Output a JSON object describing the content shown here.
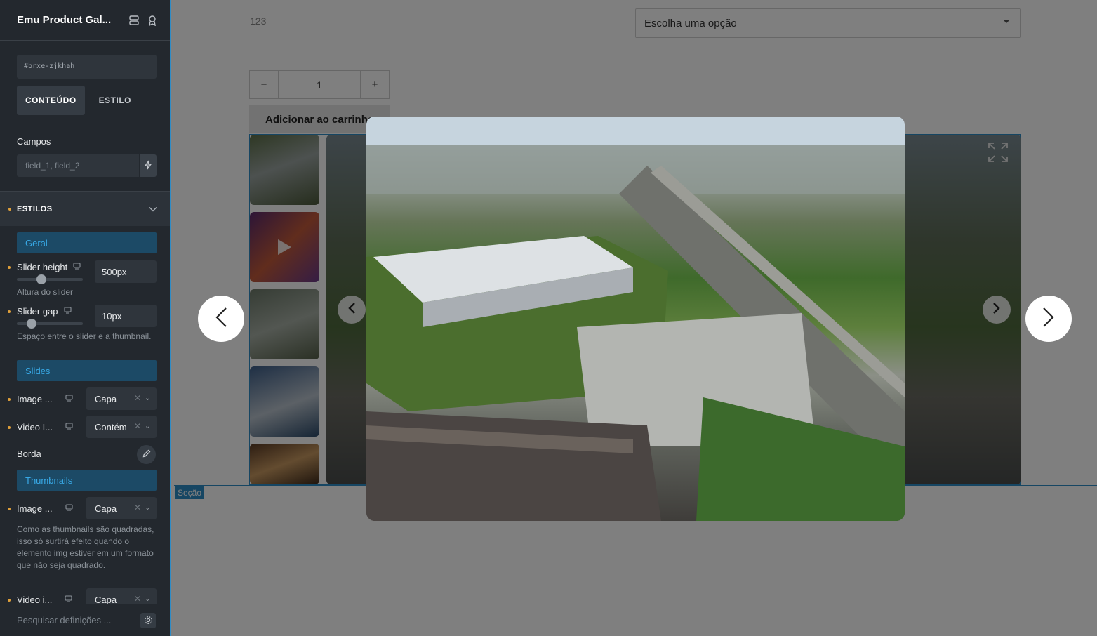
{
  "sidebar": {
    "title": "Emu Product Gal...",
    "element_id": "#brxe-zjkhah",
    "tabs": [
      "CONTEÚDO",
      "ESTILO"
    ],
    "fields_label": "Campos",
    "fields_placeholder": "field_1, field_2",
    "section_title": "ESTILOS",
    "groups": {
      "geral": "Geral",
      "slides": "Slides",
      "thumbnails": "Thumbnails"
    },
    "slider_height": {
      "label": "Slider height",
      "value": "500px",
      "hint": "Altura do slider",
      "level": 0.35
    },
    "slider_gap": {
      "label": "Slider gap",
      "value": "10px",
      "hint": "Espaço entre o slider e a thumbnail.",
      "level": 0.17
    },
    "slides_image": {
      "label": "Image ...",
      "value": "Capa"
    },
    "slides_video": {
      "label": "Video I...",
      "value": "Contém"
    },
    "border_label": "Borda",
    "thumbs_image": {
      "label": "Image ...",
      "value": "Capa",
      "hint": "Como as thumbnails são quadradas, isso só surtirá efeito quando o elemento img estiver em um formato que não seja quadrado."
    },
    "thumbs_video": {
      "label": "Video i...",
      "value": "Capa"
    },
    "search_placeholder": "Pesquisar definições ..."
  },
  "canvas": {
    "price": "123",
    "variant_select": "Escolha uma opção",
    "qty_minus": "−",
    "qty_value": "1",
    "qty_plus": "+",
    "add_to_cart": "Adicionar ao carrinho",
    "section_tag": "Seção"
  },
  "colors": {
    "sidebar_bg": "#23282e",
    "accent": "#2d8cc7",
    "group_bar": "#1c4a66",
    "modified_dot": "#e0a03a"
  }
}
